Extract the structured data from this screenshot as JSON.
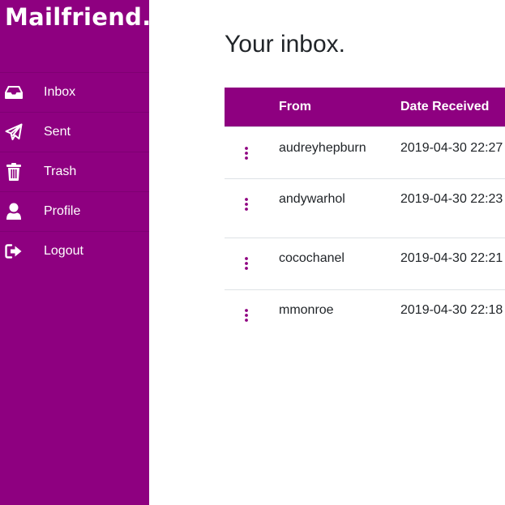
{
  "app": {
    "logo_text": "Mailfriend.",
    "brand_color": "#8e0080"
  },
  "sidebar": {
    "items": [
      {
        "label": "Inbox",
        "icon": "inbox-icon"
      },
      {
        "label": "Sent",
        "icon": "paper-plane-icon"
      },
      {
        "label": "Trash",
        "icon": "trash-icon"
      },
      {
        "label": "Profile",
        "icon": "user-icon"
      },
      {
        "label": "Logout",
        "icon": "sign-out-icon"
      }
    ]
  },
  "main": {
    "title": "Your inbox.",
    "table": {
      "headers": {
        "actions": "",
        "from": "From",
        "date": "Date Received"
      },
      "rows": [
        {
          "from": "audreyhepburn",
          "date": "2019-04-30 22:27"
        },
        {
          "from": "andywarhol",
          "date": "2019-04-30 22:23"
        },
        {
          "from": "cocochanel",
          "date": "2019-04-30 22:21"
        },
        {
          "from": "mmonroe",
          "date": "2019-04-30 22:18"
        }
      ]
    }
  }
}
